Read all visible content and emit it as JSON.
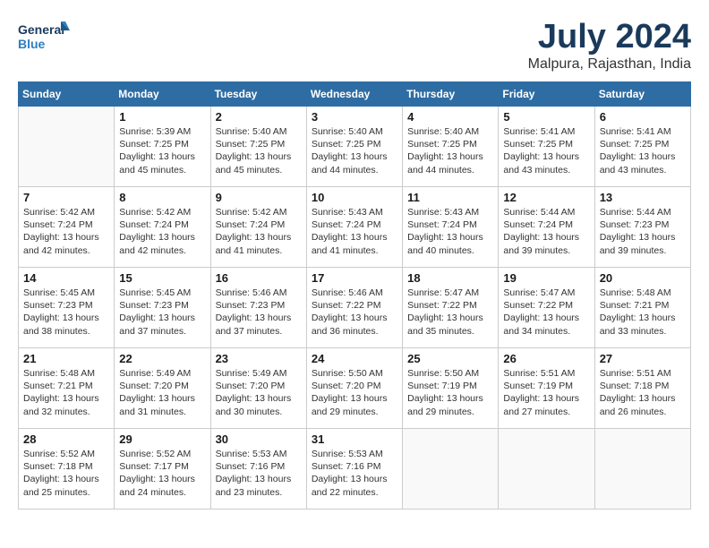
{
  "logo": {
    "line1": "General",
    "line2": "Blue"
  },
  "title": "July 2024",
  "location": "Malpura, Rajasthan, India",
  "headers": [
    "Sunday",
    "Monday",
    "Tuesday",
    "Wednesday",
    "Thursday",
    "Friday",
    "Saturday"
  ],
  "weeks": [
    [
      {
        "day": "",
        "info": ""
      },
      {
        "day": "1",
        "info": "Sunrise: 5:39 AM\nSunset: 7:25 PM\nDaylight: 13 hours\nand 45 minutes."
      },
      {
        "day": "2",
        "info": "Sunrise: 5:40 AM\nSunset: 7:25 PM\nDaylight: 13 hours\nand 45 minutes."
      },
      {
        "day": "3",
        "info": "Sunrise: 5:40 AM\nSunset: 7:25 PM\nDaylight: 13 hours\nand 44 minutes."
      },
      {
        "day": "4",
        "info": "Sunrise: 5:40 AM\nSunset: 7:25 PM\nDaylight: 13 hours\nand 44 minutes."
      },
      {
        "day": "5",
        "info": "Sunrise: 5:41 AM\nSunset: 7:25 PM\nDaylight: 13 hours\nand 43 minutes."
      },
      {
        "day": "6",
        "info": "Sunrise: 5:41 AM\nSunset: 7:25 PM\nDaylight: 13 hours\nand 43 minutes."
      }
    ],
    [
      {
        "day": "7",
        "info": "Sunrise: 5:42 AM\nSunset: 7:24 PM\nDaylight: 13 hours\nand 42 minutes."
      },
      {
        "day": "8",
        "info": "Sunrise: 5:42 AM\nSunset: 7:24 PM\nDaylight: 13 hours\nand 42 minutes."
      },
      {
        "day": "9",
        "info": "Sunrise: 5:42 AM\nSunset: 7:24 PM\nDaylight: 13 hours\nand 41 minutes."
      },
      {
        "day": "10",
        "info": "Sunrise: 5:43 AM\nSunset: 7:24 PM\nDaylight: 13 hours\nand 41 minutes."
      },
      {
        "day": "11",
        "info": "Sunrise: 5:43 AM\nSunset: 7:24 PM\nDaylight: 13 hours\nand 40 minutes."
      },
      {
        "day": "12",
        "info": "Sunrise: 5:44 AM\nSunset: 7:24 PM\nDaylight: 13 hours\nand 39 minutes."
      },
      {
        "day": "13",
        "info": "Sunrise: 5:44 AM\nSunset: 7:23 PM\nDaylight: 13 hours\nand 39 minutes."
      }
    ],
    [
      {
        "day": "14",
        "info": "Sunrise: 5:45 AM\nSunset: 7:23 PM\nDaylight: 13 hours\nand 38 minutes."
      },
      {
        "day": "15",
        "info": "Sunrise: 5:45 AM\nSunset: 7:23 PM\nDaylight: 13 hours\nand 37 minutes."
      },
      {
        "day": "16",
        "info": "Sunrise: 5:46 AM\nSunset: 7:23 PM\nDaylight: 13 hours\nand 37 minutes."
      },
      {
        "day": "17",
        "info": "Sunrise: 5:46 AM\nSunset: 7:22 PM\nDaylight: 13 hours\nand 36 minutes."
      },
      {
        "day": "18",
        "info": "Sunrise: 5:47 AM\nSunset: 7:22 PM\nDaylight: 13 hours\nand 35 minutes."
      },
      {
        "day": "19",
        "info": "Sunrise: 5:47 AM\nSunset: 7:22 PM\nDaylight: 13 hours\nand 34 minutes."
      },
      {
        "day": "20",
        "info": "Sunrise: 5:48 AM\nSunset: 7:21 PM\nDaylight: 13 hours\nand 33 minutes."
      }
    ],
    [
      {
        "day": "21",
        "info": "Sunrise: 5:48 AM\nSunset: 7:21 PM\nDaylight: 13 hours\nand 32 minutes."
      },
      {
        "day": "22",
        "info": "Sunrise: 5:49 AM\nSunset: 7:20 PM\nDaylight: 13 hours\nand 31 minutes."
      },
      {
        "day": "23",
        "info": "Sunrise: 5:49 AM\nSunset: 7:20 PM\nDaylight: 13 hours\nand 30 minutes."
      },
      {
        "day": "24",
        "info": "Sunrise: 5:50 AM\nSunset: 7:20 PM\nDaylight: 13 hours\nand 29 minutes."
      },
      {
        "day": "25",
        "info": "Sunrise: 5:50 AM\nSunset: 7:19 PM\nDaylight: 13 hours\nand 29 minutes."
      },
      {
        "day": "26",
        "info": "Sunrise: 5:51 AM\nSunset: 7:19 PM\nDaylight: 13 hours\nand 27 minutes."
      },
      {
        "day": "27",
        "info": "Sunrise: 5:51 AM\nSunset: 7:18 PM\nDaylight: 13 hours\nand 26 minutes."
      }
    ],
    [
      {
        "day": "28",
        "info": "Sunrise: 5:52 AM\nSunset: 7:18 PM\nDaylight: 13 hours\nand 25 minutes."
      },
      {
        "day": "29",
        "info": "Sunrise: 5:52 AM\nSunset: 7:17 PM\nDaylight: 13 hours\nand 24 minutes."
      },
      {
        "day": "30",
        "info": "Sunrise: 5:53 AM\nSunset: 7:16 PM\nDaylight: 13 hours\nand 23 minutes."
      },
      {
        "day": "31",
        "info": "Sunrise: 5:53 AM\nSunset: 7:16 PM\nDaylight: 13 hours\nand 22 minutes."
      },
      {
        "day": "",
        "info": ""
      },
      {
        "day": "",
        "info": ""
      },
      {
        "day": "",
        "info": ""
      }
    ]
  ]
}
